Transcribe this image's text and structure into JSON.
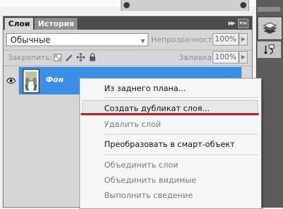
{
  "tabs": [
    {
      "label": "Слои"
    },
    {
      "label": "История"
    }
  ],
  "tab_controls": {
    "collapse_icon": "double-chevron-right",
    "menu_icon": "panel-menu"
  },
  "blend_mode": {
    "value": "Обычные"
  },
  "opacity": {
    "label": "Непрозрачность:",
    "value": "100%"
  },
  "lock": {
    "label": "Закрепить:",
    "icons": [
      "lock-transparency",
      "lock-brush",
      "lock-move",
      "lock-all"
    ]
  },
  "fill": {
    "label": "Заливка:",
    "value": "100%"
  },
  "layer": {
    "name": "Фон",
    "visible_icon": "eye"
  },
  "context_menu": {
    "items": [
      {
        "label": "Из заднего плана...",
        "disabled": false
      },
      {
        "label": "Создать дубликат слоя...",
        "disabled": false,
        "highlighted": true
      },
      {
        "label": "Удалить слой",
        "disabled": true
      },
      {
        "label": "Преобразовать в смарт-объект",
        "disabled": false
      },
      {
        "label": "Объединить слои",
        "disabled": true
      },
      {
        "label": "Объединить видимые",
        "disabled": true
      },
      {
        "label": "Выполнить сведение",
        "disabled": true
      }
    ]
  },
  "right_toolbar": {
    "icons": [
      "layers",
      "history"
    ]
  },
  "colors": {
    "selection": "#3a8ee6",
    "annotation": "#c8141b"
  }
}
